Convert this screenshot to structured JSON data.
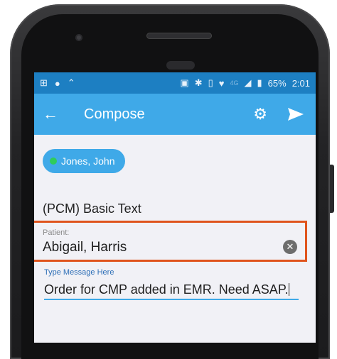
{
  "status_bar": {
    "left_icons": [
      "sim-icon",
      "android-icon",
      "notification-icon"
    ],
    "right_icons": [
      "nfc-icon",
      "bluetooth-icon",
      "vibrate-icon",
      "wifi-icon",
      "lte-icon",
      "signal-icon",
      "battery-icon"
    ],
    "network_label": "4G",
    "battery": "65%",
    "time": "2:01"
  },
  "toolbar": {
    "back_icon": "←",
    "title": "Compose",
    "settings_icon": "gear-icon",
    "send_icon": "send-icon"
  },
  "compose": {
    "recipient_chip": "Jones, John",
    "subject": "(PCM) Basic Text",
    "patient_label": "Patient:",
    "patient_value": "Abigail, Harris",
    "message_label": "Type Message Here",
    "message_text": "Order for CMP added in EMR. Need ASAP."
  },
  "colors": {
    "status_bar": "#1d7fc2",
    "toolbar": "#3fa9e8",
    "highlight": "#e0541d",
    "online_dot": "#2fcc5a"
  }
}
